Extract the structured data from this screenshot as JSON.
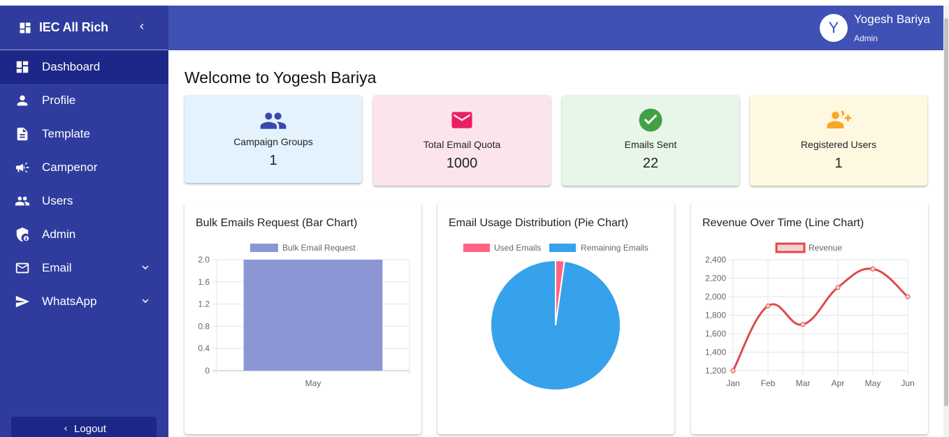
{
  "sidebar": {
    "brand": "IEC All Rich",
    "items": [
      {
        "label": "Dashboard",
        "icon": "dashboard-icon",
        "active": true
      },
      {
        "label": "Profile",
        "icon": "person-icon"
      },
      {
        "label": "Template",
        "icon": "document-icon"
      },
      {
        "label": "Campenor",
        "icon": "megaphone-icon"
      },
      {
        "label": "Users",
        "icon": "group-icon"
      },
      {
        "label": "Admin",
        "icon": "admin-shield-icon"
      },
      {
        "label": "Email",
        "icon": "mail-icon",
        "expandable": true
      },
      {
        "label": "WhatsApp",
        "icon": "send-icon",
        "expandable": true
      }
    ],
    "logout": "Logout"
  },
  "header": {
    "avatar_letter": "Y",
    "user_name": "Yogesh Bariya",
    "user_role": "Admin"
  },
  "main": {
    "welcome": "Welcome to Yogesh Bariya",
    "stats": [
      {
        "label": "Campaign Groups",
        "value": "1",
        "icon": "group-icon",
        "bg": "#e3f2fd",
        "color": "#3949ab"
      },
      {
        "label": "Total Email Quota",
        "value": "1000",
        "icon": "mail-icon",
        "bg": "#fce4ec",
        "color": "#e91e63"
      },
      {
        "label": "Emails Sent",
        "value": "22",
        "icon": "check-circle-icon",
        "bg": "#e8f5e9",
        "color": "#43a047"
      },
      {
        "label": "Registered Users",
        "value": "1",
        "icon": "person-add-icon",
        "bg": "#fff8e1",
        "color": "#f9a825"
      }
    ]
  },
  "colors": {
    "sidebar": "#2f3c9e",
    "sidebar_active": "#1c2787",
    "header": "#3f51b5",
    "bar": "#8c96d4",
    "pie_used": "#ff6384",
    "pie_remaining": "#36a2eb",
    "line": "#e0494c"
  },
  "chart_data": [
    {
      "type": "bar",
      "title": "Bulk Emails Request (Bar Chart)",
      "categories": [
        "May"
      ],
      "series": [
        {
          "name": "Bulk Email Request",
          "values": [
            2
          ]
        }
      ],
      "ylim": [
        0,
        2
      ],
      "yticks": [
        "2.0",
        "1.6",
        "1.2",
        "0.8",
        "0.4",
        "0"
      ],
      "legend": "top",
      "grid": true
    },
    {
      "type": "pie",
      "title": "Email Usage Distribution (Pie Chart)",
      "labels": [
        "Used Emails",
        "Remaining Emails"
      ],
      "values": [
        22,
        978
      ],
      "legend": "top"
    },
    {
      "type": "line",
      "title": "Revenue Over Time (Line Chart)",
      "categories": [
        "Jan",
        "Feb",
        "Mar",
        "Apr",
        "May",
        "Jun"
      ],
      "series": [
        {
          "name": "Revenue",
          "values": [
            1200,
            1900,
            1700,
            2100,
            2300,
            2000
          ]
        }
      ],
      "ylim": [
        1200,
        2400
      ],
      "yticks": [
        "2,400",
        "2,200",
        "2,000",
        "1,800",
        "1,600",
        "1,400",
        "1,200"
      ],
      "legend": "top",
      "grid": true
    }
  ]
}
